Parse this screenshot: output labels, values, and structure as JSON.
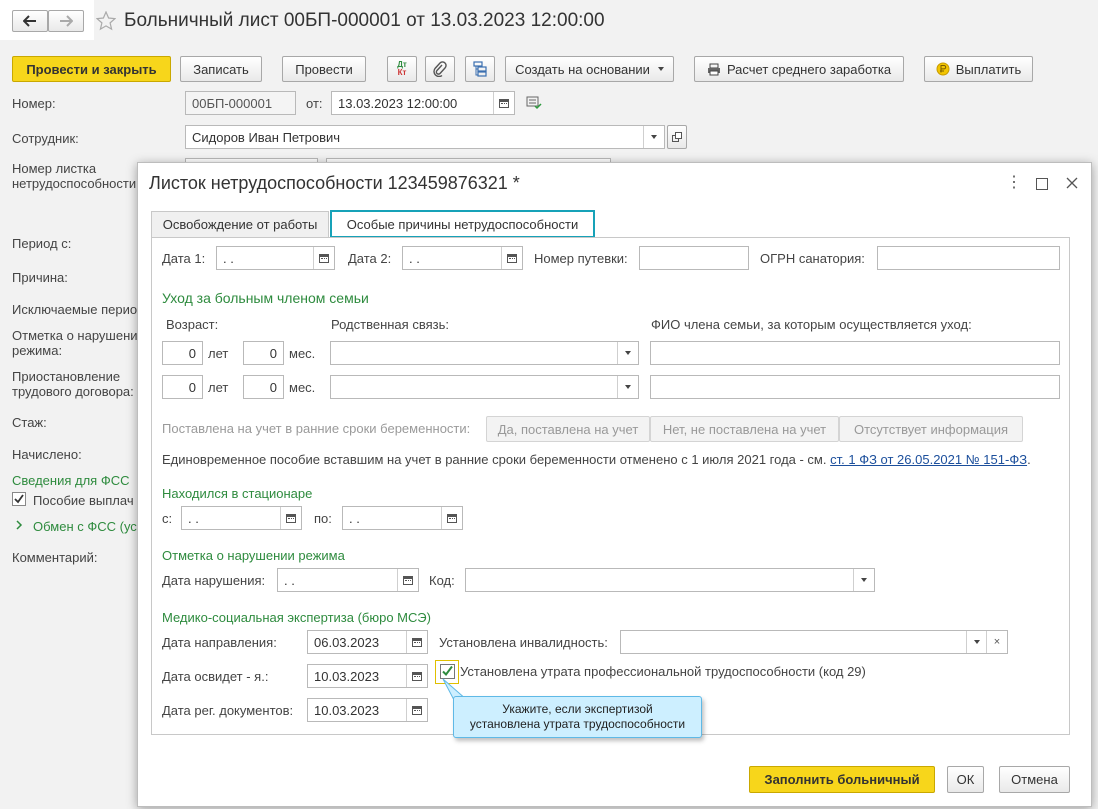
{
  "main": {
    "title": "Больничный лист 00БП-000001 от 13.03.2023 12:00:00",
    "toolbar": {
      "post_close": "Провести и закрыть",
      "save": "Записать",
      "post": "Провести",
      "dt_kt_top": "Дт",
      "dt_kt_bottom": "Кт",
      "create_based": "Создать на основании",
      "avg_earnings": "Расчет среднего заработка",
      "pay": "Выплатить"
    },
    "number_label": "Номер:",
    "number_value": "00БП-000001",
    "from_label": "от:",
    "date_value": "13.03.2023 12:00:00",
    "employee_label": "Сотрудник:",
    "employee_value": "Сидоров Иван Петрович",
    "sick_number_label_1": "Номер листка",
    "sick_number_label_2": "нетрудоспособности",
    "period_label": "Период с:",
    "reason_label": "Причина:",
    "excluded_label": "Исключаемые перио",
    "violation_label_1": "Отметка о нарушени",
    "violation_label_2": "режима:",
    "suspension_label_1": "Приостановление",
    "suspension_label_2": "трудового договора:",
    "experience_label": "Стаж:",
    "accrued_label": "Начислено:",
    "fss_info": "Сведения для ФСС",
    "benefit_paid": "Пособие выплач",
    "fss_exchange": "Обмен с ФСС (ус",
    "comment_label": "Комментарий:"
  },
  "dialog": {
    "title": "Листок нетрудоспособности 123459876321 *",
    "tabs": [
      "Освобождение от работы",
      "Особые причины нетрудоспособности"
    ],
    "date1_label": "Дата 1:",
    "date2_label": "Дата 2:",
    "empty_date": " .  .",
    "voucher_label": "Номер путевки:",
    "ogrn_label": "ОГРН санатория:",
    "family_care_header": "Уход за больным членом семьи",
    "age_label": "Возраст:",
    "relation_label": "Родственная связь:",
    "fio_label": "ФИО члена семьи, за которым осуществляется уход:",
    "zero": "0",
    "years": "лет",
    "months": "мес.",
    "pregnancy_label": "Поставлена на учет в ранние сроки беременности:",
    "pregnancy_options": [
      "Да, поставлена на учет",
      "Нет, не поставлена на учет",
      "Отсутствует информация"
    ],
    "lump_sum_text": "Единовременное пособие вставшим на учет в ранние сроки беременности отменено с 1 июля 2021 года - см.",
    "lump_sum_link": "ст. 1 ФЗ от 26.05.2021 № 151-ФЗ",
    "lump_sum_dot": ".",
    "hospital_header": "Находился в стационаре",
    "from_short": "с:",
    "to_short": "по:",
    "violation_header": "Отметка о нарушении режима",
    "violation_date_label": "Дата нарушения:",
    "code_label": "Код:",
    "mse_header": "Медико-социальная экспертиза (бюро МСЭ)",
    "referral_label": "Дата направления:",
    "referral_value": "06.03.2023",
    "disability_label": "Установлена инвалидность:",
    "exam_label": "Дата освидет - я.:",
    "exam_value": "10.03.2023",
    "loss_label": "Установлена утрата профессиональной трудоспособности (код 29)",
    "reg_label": "Дата рег. документов:",
    "reg_value": "10.03.2023",
    "tooltip_1": "Укажите, если экспертизой",
    "tooltip_2": "установлена утрата трудоспособности",
    "fill_button": "Заполнить больничный",
    "ok_button": "ОК",
    "cancel_button": "Отмена"
  }
}
